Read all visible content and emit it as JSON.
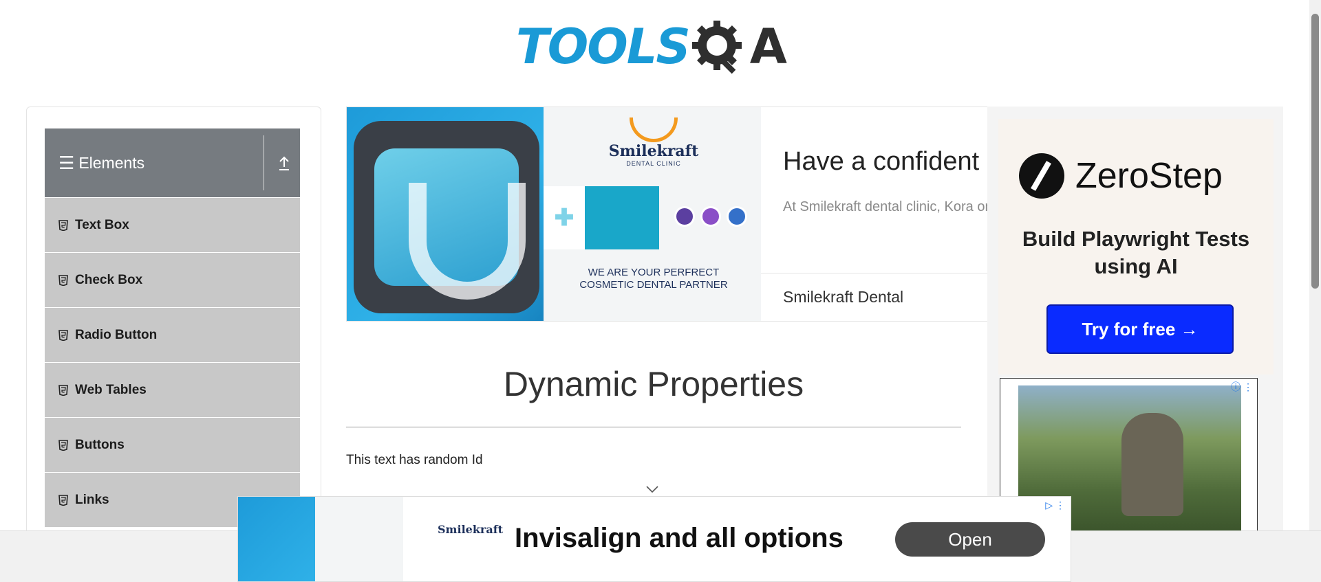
{
  "header": {
    "logo_tools": "TOOLS",
    "logo_qa": "A"
  },
  "sidebar": {
    "group_title": "Elements",
    "items": [
      {
        "label": "Text Box"
      },
      {
        "label": "Check Box"
      },
      {
        "label": "Radio Button"
      },
      {
        "label": "Web Tables"
      },
      {
        "label": "Buttons"
      },
      {
        "label": "Links"
      }
    ]
  },
  "ad_top": {
    "brand_name": "Smilekraft",
    "brand_sub": "DENTAL CLINIC",
    "partner_text": "WE ARE YOUR PERFRECT COSMETIC DENTAL PARTNER",
    "headline": "Have a confident",
    "description": "At Smilekraft dental clinic, Kora on quality.",
    "brand_footer": "Smilekraft Dental"
  },
  "main": {
    "title": "Dynamic Properties",
    "random_text": "This text has random Id"
  },
  "ad_right": {
    "brand": "ZeroStep",
    "tagline": "Build Playwright Tests using AI",
    "cta": "Try for free →"
  },
  "ad_bottom": {
    "brand": "Smilekraft",
    "headline": "Invisalign and all options",
    "cta": "Open"
  },
  "colors": {
    "brand_blue": "#1a9ad6",
    "sidebar_header": "#767b80",
    "sidebar_item": "#c8c8c8",
    "cta_blue": "#0a2bff"
  }
}
